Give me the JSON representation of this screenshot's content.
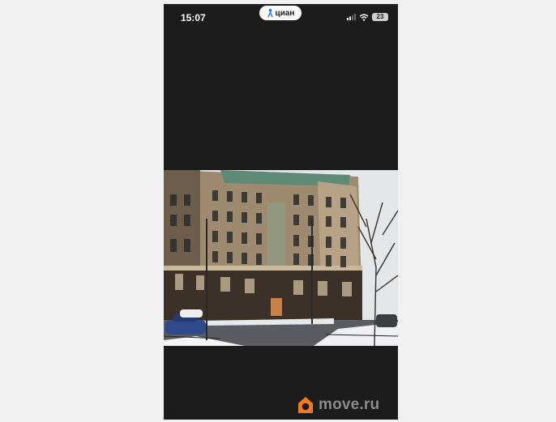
{
  "status_bar": {
    "time": "15:07",
    "battery_level": "23",
    "icons": [
      "signal-icon",
      "wifi-icon",
      "battery-icon"
    ]
  },
  "app_badge": {
    "label": "циан",
    "icon": "location-pin-icon",
    "accent": "#1f6cff"
  },
  "photo": {
    "subject": "building-photo"
  },
  "watermark": {
    "text": "move.ru",
    "icon": "house-logo-icon",
    "accent": "#f47a20"
  },
  "colors": {
    "page_background": "#f1f1f1",
    "phone_background": "#1c1c1c"
  }
}
